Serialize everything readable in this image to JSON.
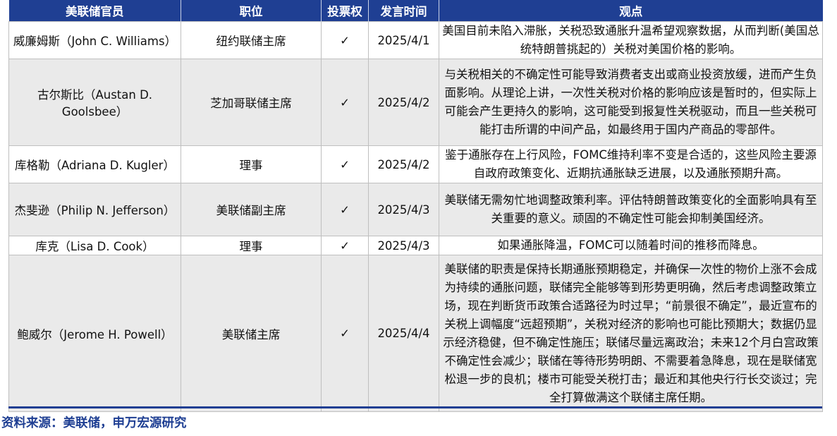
{
  "table": {
    "headers": {
      "official": "美联储官员",
      "position": "职位",
      "vote": "投票权",
      "date": "发言时间",
      "view": "观点"
    },
    "rows": [
      {
        "official": "威廉姆斯（John C. Williams）",
        "position": "纽约联储主席",
        "vote": "✓",
        "date": "2025/4/1",
        "view": "美国目前未陷入滞胀，关税恐致通胀升温希望观察数据，从而判断(美国总统特朗普挑起的）关税对美国价格的影响。"
      },
      {
        "official": "古尔斯比（Austan D. Goolsbee）",
        "position": "芝加哥联储主席",
        "vote": "✓",
        "date": "2025/4/2",
        "view": "与关税相关的不确定性可能导致消费者支出或商业投资放缓，进而产生负面影响。从理论上讲，一次性关税对价格的影响应该是暂时的，但实际上可能会产生更持久的影响，这可能受到报复性关税驱动，而且一些关税可能打击所谓的中间产品，如最终用于国内产商品的零部件。"
      },
      {
        "official": "库格勒（Adriana D. Kugler）",
        "position": "理事",
        "vote": "✓",
        "date": "2025/4/2",
        "view": "鉴于通胀存在上行风险，FOMC维持利率不变是合适的，这些风险主要源自政府政策变化、近期抗通胀缺乏进展，以及通胀预期升高。"
      },
      {
        "official": "杰斐逊（Philip N. Jefferson）",
        "position": "美联储副主席",
        "vote": "✓",
        "date": "2025/4/3",
        "view": "美联储无需匆忙地调整政策利率。评估特朗普政策变化的全面影响具有至关重要的意义。顽固的不确定性可能会抑制美国经济。"
      },
      {
        "official": "库克（Lisa D. Cook）",
        "position": "理事",
        "vote": "✓",
        "date": "2025/4/3",
        "view": "如果通胀降温，FOMC可以随着时间的推移而降息。"
      },
      {
        "official": "鲍威尔（Jerome H. Powell）",
        "position": "美联储主席",
        "vote": "✓",
        "date": "2025/4/4",
        "view": "美联储的职责是保持长期通胀预期稳定，并确保一次性的物价上涨不会成为持续的通胀问题，联储完全能够等到形势更明确，然后考虑调整政策立场，现在判断货币政策合适路径为时过早；“前景很不确定”，最近宣布的关税上调幅度“远超预期”，关税对经济的影响也可能比预期大；数据仍显示经济稳健，但不确定性施压；联储尽量远离政治；未来12个月白宫政策不确定性会减少；联储在等待形势明朗、不需要着急降息，现在是联储宽松退一步的良机；楼市可能受关税打击；最近和其他央行行长交谈过；完全打算做满这个联储主席任期。"
      }
    ]
  },
  "source": "资料来源：美联储，申万宏源研究",
  "colors": {
    "header_bg": "#1f3f93",
    "header_text": "#ffffff",
    "shaded_row": "#eaeaea",
    "source_text": "#1f3f93"
  }
}
